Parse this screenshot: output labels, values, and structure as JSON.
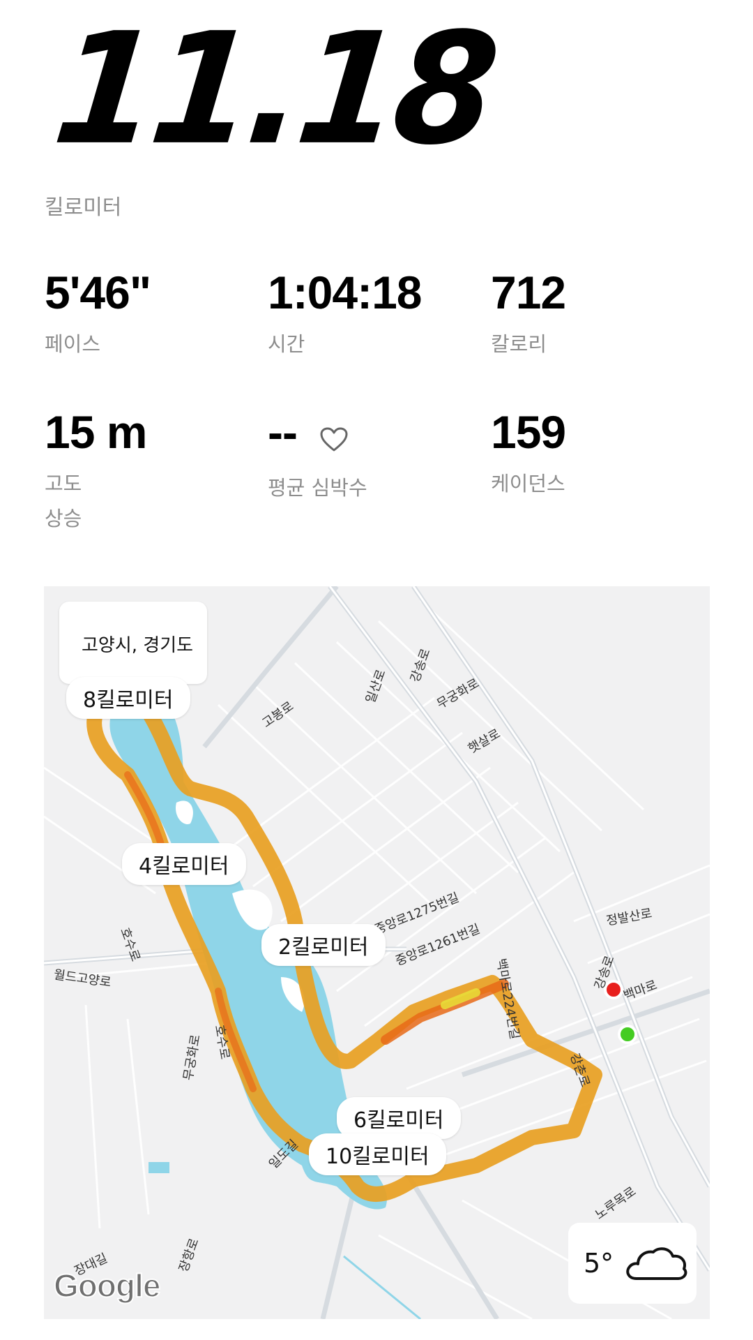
{
  "summary": {
    "distance": "11.18",
    "distance_unit": "킬로미터"
  },
  "stats": {
    "pace": {
      "value": "5'46\"",
      "label": "페이스"
    },
    "time": {
      "value": "1:04:18",
      "label": "시간"
    },
    "calories": {
      "value": "712",
      "label": "칼로리"
    },
    "elevation": {
      "value": "15 m",
      "label": "고도",
      "sublabel": "상승"
    },
    "heart_rate": {
      "value": "--",
      "label": "평균 심박수",
      "icon": "heart-outline-icon"
    },
    "cadence": {
      "value": "159",
      "label": "케이던스"
    }
  },
  "map": {
    "location_label": "고양시, 경기도",
    "km_markers": {
      "km2": "2킬로미터",
      "km4": "4킬로미터",
      "km6": "6킬로미터",
      "km8": "8킬로미터",
      "km10": "10킬로미터"
    },
    "streets": {
      "s1": "고봉로",
      "s2": "일산로",
      "s3": "강송로",
      "s4": "무궁화로",
      "s5": "햇살로",
      "s6": "중앙로1275번길",
      "s7": "중앙로1261번길",
      "s8": "정발산로",
      "s9": "강송로",
      "s10": "백마로",
      "s11": "백마로224번길",
      "s12": "강촌로",
      "s13": "호수로",
      "s14": "호수로",
      "s15": "월드고양로",
      "s16": "무궁화로",
      "s17": "일도길",
      "s18": "노루목로",
      "s19": "장대길",
      "s20": "장항로"
    },
    "attribution": "Google",
    "route_color": "#f0a020",
    "start_color": "#44cc22",
    "end_color": "#e8201e",
    "water_color": "#8fd5e8"
  },
  "weather": {
    "temperature": "5°",
    "icon": "cloud-icon"
  }
}
